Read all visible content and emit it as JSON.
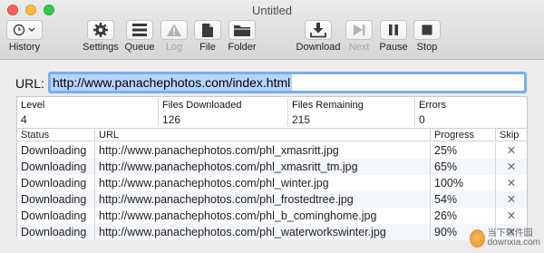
{
  "window": {
    "title": "Untitled"
  },
  "toolbar": {
    "history_label": "History",
    "settings_label": "Settings",
    "queue_label": "Queue",
    "log_label": "Log",
    "file_label": "File",
    "folder_label": "Folder",
    "download_label": "Download",
    "next_label": "Next",
    "pause_label": "Pause",
    "stop_label": "Stop"
  },
  "url": {
    "label": "URL:",
    "value": "http://www.panachephotos.com/index.html"
  },
  "stats": {
    "headers": [
      "Level",
      "Files Downloaded",
      "Files Remaining",
      "Errors"
    ],
    "values": [
      "4",
      "126",
      "215",
      "0"
    ]
  },
  "table": {
    "headers": {
      "status": "Status",
      "url": "URL",
      "progress": "Progress",
      "skip": "Skip"
    },
    "rows": [
      {
        "status": "Downloading",
        "url": "http://www.panachephotos.com/phl_xmasritt.jpg",
        "progress": "25%",
        "skip": "✕"
      },
      {
        "status": "Downloading",
        "url": "http://www.panachephotos.com/phl_xmasritt_tm.jpg",
        "progress": "65%",
        "skip": "✕"
      },
      {
        "status": "Downloading",
        "url": "http://www.panachephotos.com/phl_winter.jpg",
        "progress": "100%",
        "skip": "✕"
      },
      {
        "status": "Downloading",
        "url": "http://www.panachephotos.com/phl_frostedtree.jpg",
        "progress": "54%",
        "skip": "✕"
      },
      {
        "status": "Downloading",
        "url": "http://www.panachephotos.com/phl_b_cominghome.jpg",
        "progress": "26%",
        "skip": "✕"
      },
      {
        "status": "Downloading",
        "url": "http://www.panachephotos.com/phl_waterworkswinter.jpg",
        "progress": "90%",
        "skip": "✕"
      }
    ]
  },
  "watermark": {
    "line1": "当下软件园",
    "line2": "downxia.com"
  }
}
